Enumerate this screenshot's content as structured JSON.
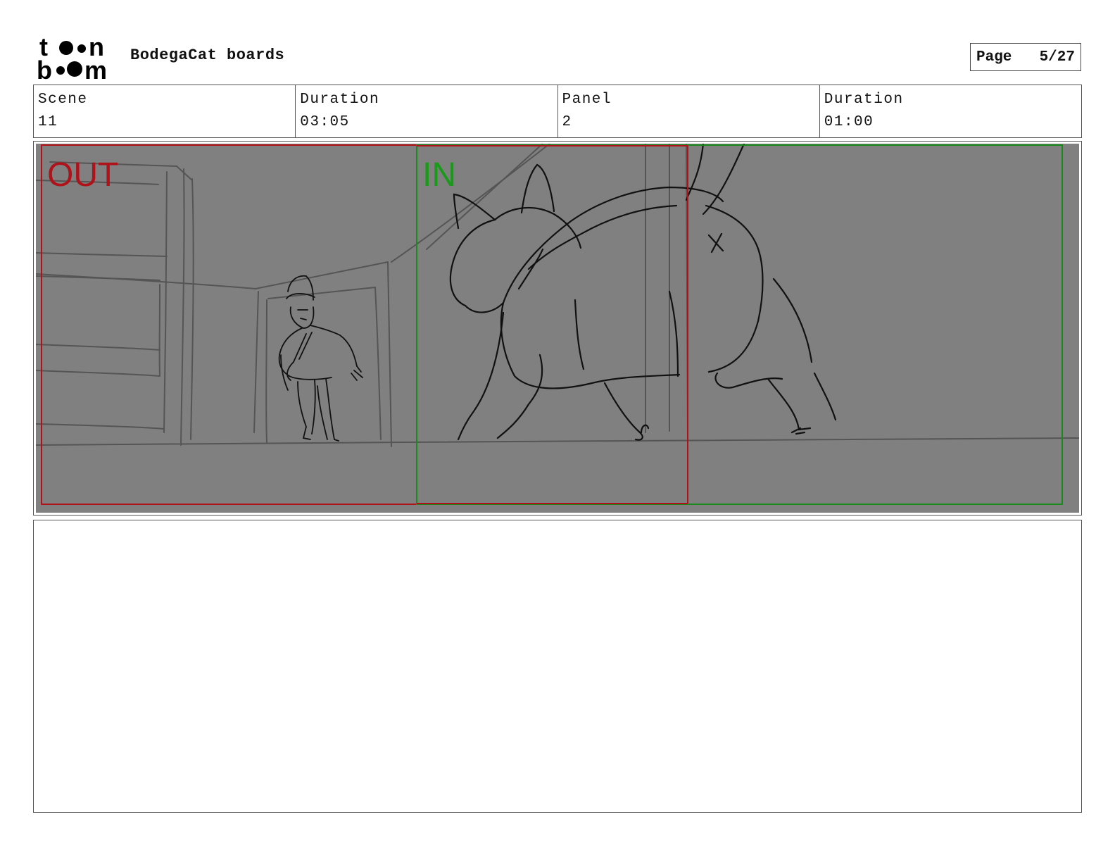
{
  "header": {
    "logo_name": "toon boom",
    "project_title": "BodegaCat boards",
    "page_label": "Page",
    "page_number": "5/27"
  },
  "info": {
    "scene_label": "Scene",
    "scene_value": "11",
    "scene_duration_label": "Duration",
    "scene_duration_value": "03:05",
    "panel_label": "Panel",
    "panel_value": "2",
    "panel_duration_label": "Duration",
    "panel_duration_value": "01:00"
  },
  "frame": {
    "out_label": "OUT",
    "in_label": "IN",
    "out_color": "#b0121a",
    "in_color": "#1a9a1a",
    "background": "#808080"
  },
  "notes": {
    "text": ""
  }
}
